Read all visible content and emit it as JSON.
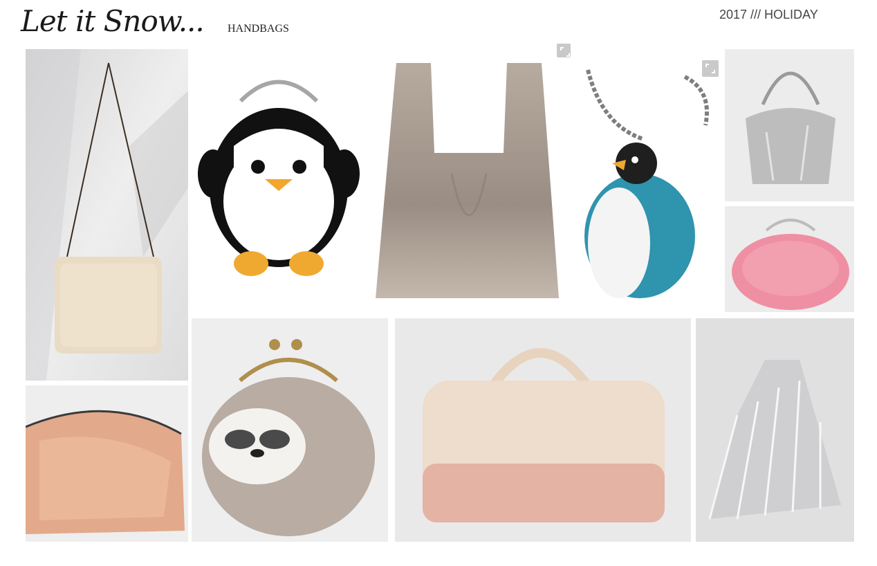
{
  "header": {
    "title": "Let it Snow...",
    "subtitle": "HANDBAGS",
    "season": "2017 /// HOLIDAY"
  },
  "board": {
    "tiles": [
      {
        "name": "shearling-chain-bag",
        "bg": "#e6e6e6"
      },
      {
        "name": "penguin-coin-purse",
        "bg": "#ffffff"
      },
      {
        "name": "faux-fur-tote",
        "bg": "#ffffff"
      },
      {
        "name": "penguin-chain-wallet",
        "bg": "#ffffff"
      },
      {
        "name": "silver-bucket-bag",
        "bg": "#ececec"
      },
      {
        "name": "pink-fur-purse",
        "bg": "#ececec"
      },
      {
        "name": "rose-gold-clutch",
        "bg": "#ededed"
      },
      {
        "name": "sloth-felt-purse",
        "bg": "#eeeeee"
      },
      {
        "name": "sequin-duffel-bag",
        "bg": "#e9e9e9"
      },
      {
        "name": "silver-pleated-bag",
        "bg": "#e0e0e0"
      }
    ],
    "zoom_icon": "expand-icon"
  }
}
